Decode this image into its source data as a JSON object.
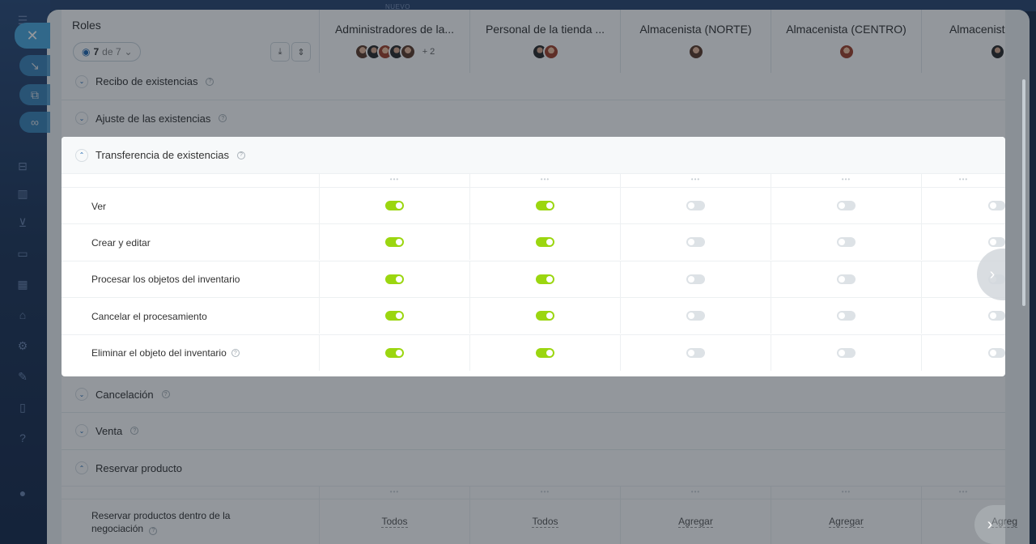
{
  "background": {
    "new_tag": "NUEVO"
  },
  "header": {
    "title": "Roles",
    "count_current": "7",
    "count_of": "de 7",
    "roles": [
      {
        "name": "Administradores de la...",
        "avatars": 5,
        "extra": "+ 2"
      },
      {
        "name": "Personal de la tienda ...",
        "avatars": 2,
        "extra": ""
      },
      {
        "name": "Almacenista (NORTE)",
        "avatars": 1,
        "extra": ""
      },
      {
        "name": "Almacenista (CENTRO)",
        "avatars": 1,
        "extra": ""
      },
      {
        "name": "Almacenist",
        "avatars": 1,
        "extra": ""
      }
    ]
  },
  "sections": {
    "recibo": "Recibo de existencias",
    "ajuste": "Ajuste de las existencias",
    "transferencia": "Transferencia de existencias",
    "cancelacion": "Cancelación",
    "venta": "Venta",
    "reservar": "Reservar producto"
  },
  "transfer_perms": [
    {
      "label": "Ver",
      "values": [
        true,
        true,
        false,
        false,
        false
      ]
    },
    {
      "label": "Crear y editar",
      "values": [
        true,
        true,
        false,
        false,
        false
      ]
    },
    {
      "label": "Procesar los objetos del inventario",
      "values": [
        true,
        true,
        false,
        false,
        false
      ]
    },
    {
      "label": "Cancelar el procesamiento",
      "values": [
        true,
        true,
        false,
        false,
        false
      ]
    },
    {
      "label": "Eliminar el objeto del inventario",
      "values": [
        true,
        true,
        false,
        false,
        false
      ],
      "help": true
    }
  ],
  "reserve_perm": {
    "label_line1": "Reservar productos dentro de la",
    "label_line2": "negociación",
    "values": [
      "Todos",
      "Todos",
      "Agregar",
      "Agregar",
      "Agreg"
    ]
  },
  "colors": {
    "toggle_on": "#9bd610",
    "toggle_off": "#dde2e6",
    "accent": "#2067b0"
  }
}
